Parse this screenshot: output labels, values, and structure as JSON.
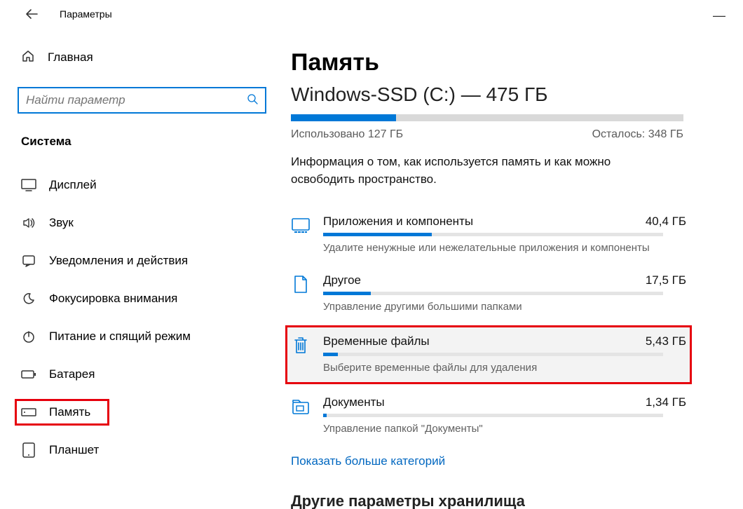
{
  "window": {
    "title": "Параметры"
  },
  "sidebar": {
    "home_label": "Главная",
    "search_placeholder": "Найти параметр",
    "section_label": "Система",
    "items": [
      {
        "label": "Дисплей",
        "icon": "display-icon"
      },
      {
        "label": "Звук",
        "icon": "sound-icon"
      },
      {
        "label": "Уведомления и действия",
        "icon": "notifications-icon"
      },
      {
        "label": "Фокусировка внимания",
        "icon": "focus-icon"
      },
      {
        "label": "Питание и спящий режим",
        "icon": "power-icon"
      },
      {
        "label": "Батарея",
        "icon": "battery-icon"
      },
      {
        "label": "Память",
        "icon": "storage-icon",
        "highlighted": true
      },
      {
        "label": "Планшет",
        "icon": "tablet-icon"
      }
    ]
  },
  "main": {
    "title": "Память",
    "drive": "Windows-SSD (C:) — 475 ГБ",
    "used_pct": 26.7,
    "used_label": "Использовано 127 ГБ",
    "free_label": "Осталось: 348 ГБ",
    "description": "Информация о том, как используется память и как можно освободить пространство.",
    "categories": [
      {
        "title": "Приложения и компоненты",
        "size": "40,4 ГБ",
        "pct": 32,
        "desc": "Удалите ненужные или нежелательные приложения и компоненты",
        "icon": "apps-icon"
      },
      {
        "title": "Другое",
        "size": "17,5 ГБ",
        "pct": 14,
        "desc": "Управление другими большими папками",
        "icon": "file-icon"
      },
      {
        "title": "Временные файлы",
        "size": "5,43 ГБ",
        "pct": 4.3,
        "desc": "Выберите временные файлы для удаления",
        "icon": "trash-icon",
        "highlighted": true
      },
      {
        "title": "Документы",
        "size": "1,34 ГБ",
        "pct": 1.1,
        "desc": "Управление папкой \"Документы\"",
        "icon": "documents-icon"
      }
    ],
    "more_link": "Показать больше категорий",
    "next_heading": "Другие параметры хранилища"
  },
  "colors": {
    "accent": "#0078d7",
    "highlight_border": "#e6000d"
  }
}
